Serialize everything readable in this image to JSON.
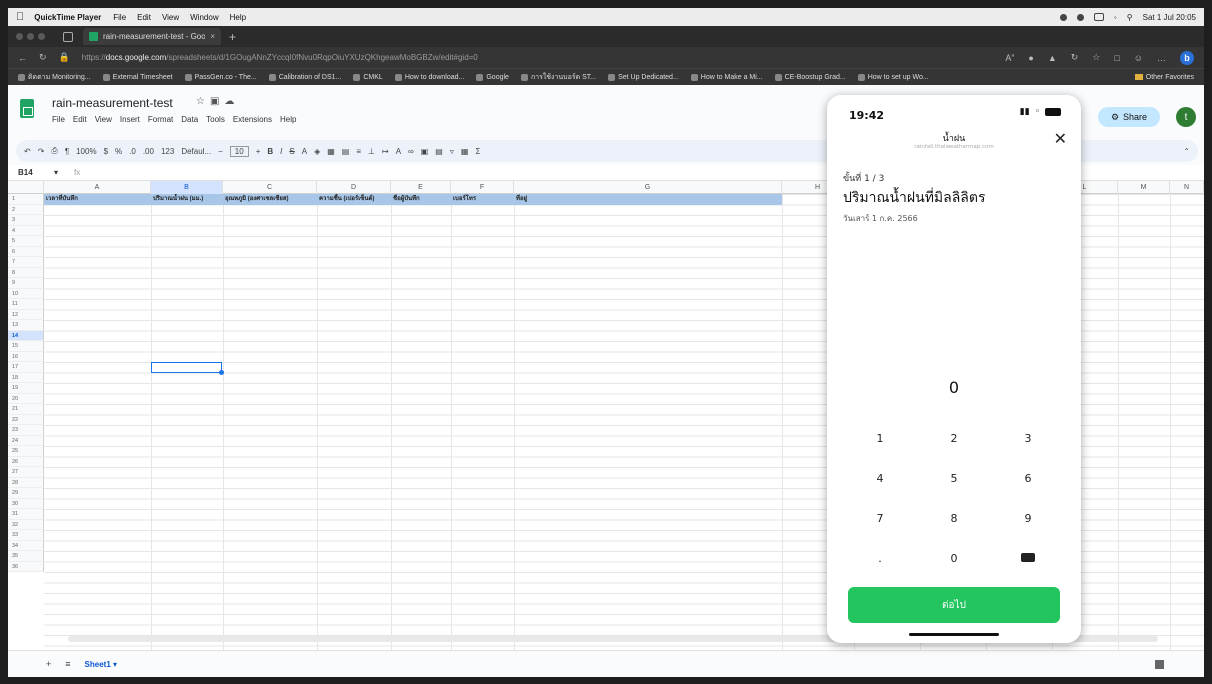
{
  "menubar": {
    "app": "QuickTime Player",
    "items": [
      "File",
      "Edit",
      "View",
      "Window",
      "Help"
    ],
    "datetime": "Sat 1 Jul 20:05"
  },
  "browser": {
    "tab_title": "rain-measurement-test - Goo",
    "url_prefix": "https://",
    "url_host": "docs.google.com",
    "url_path": "/spreadsheets/d/1GOugANnZYccqI0fNvu0RqpOiuYXUzQKhgeawMoBGBZw/edit#gid=0",
    "bookmarks": [
      "ติดตาม Monitoring...",
      "External Timesheet",
      "PassGen.co - The...",
      "Calibration of DS1...",
      "CMKL",
      "How to download...",
      "Google",
      "การใช้งานบอร์ด ST...",
      "Set Up Dedicated...",
      "How to Make a Mi...",
      "CE-Boostup Grad...",
      "How to set up Wo..."
    ],
    "other_favorites": "Other Favorites"
  },
  "sheets": {
    "doc_title": "rain-measurement-test",
    "menu": [
      "File",
      "Edit",
      "View",
      "Insert",
      "Format",
      "Data",
      "Tools",
      "Extensions",
      "Help"
    ],
    "share_label": "Share",
    "avatar_letter": "t",
    "zoom": "100%",
    "font_name": "Defaul...",
    "font_size": "10",
    "cell_ref": "B14",
    "sheet_tab": "Sheet1",
    "columns": [
      "A",
      "B",
      "C",
      "D",
      "E",
      "F",
      "G",
      "H",
      "I",
      "J",
      "K",
      "L",
      "M",
      "N"
    ],
    "header_row": [
      "เวลาที่บันทึก",
      "ปริมาณน้ำฝน (มม.)",
      "อุณหภูมิ (องศาเซลเซียส)",
      "ความชื้น (เปอร์เซ็นต์)",
      "ชื่อผู้บันทึก",
      "เบอร์โทร",
      "ที่อยู่"
    ],
    "row_count": 36,
    "selected_row": 14
  },
  "phone": {
    "time": "19:42",
    "title": "น้ำฝน",
    "url": "rainfall.thaiweathermap.com",
    "step": "ขั้นที่ 1 / 3",
    "heading": "ปริมาณน้ำฝนที่มิลลิลิตร",
    "date": "วันเสาร์ 1 ก.ค. 2566",
    "value": "0",
    "keys": [
      "1",
      "2",
      "3",
      "4",
      "5",
      "6",
      "7",
      "8",
      "9",
      ".",
      "0",
      "backspace"
    ],
    "next_label": "ต่อไป"
  },
  "colors": {
    "sheets_green": "#1fa463",
    "header_fill": "#a8c7e8",
    "selection": "#1a73e8",
    "next_button": "#22c55e"
  }
}
